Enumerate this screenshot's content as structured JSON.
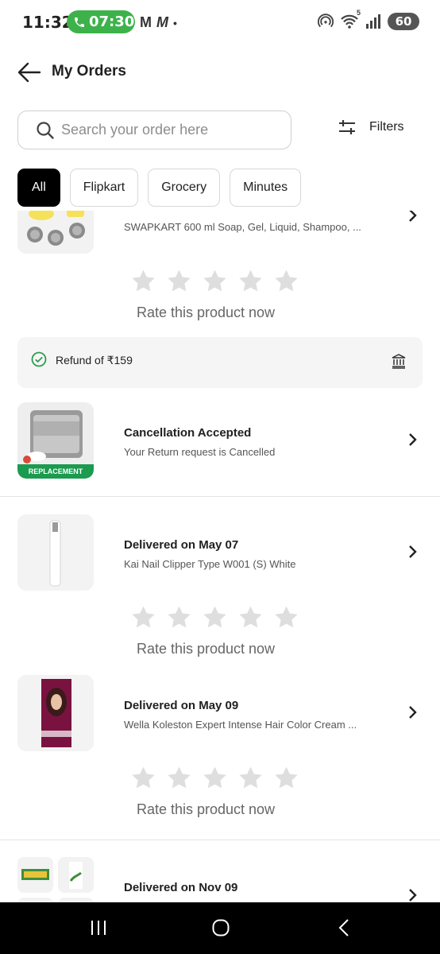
{
  "status_bar": {
    "time": "11:32",
    "call_time": "07:30",
    "left_icons": [
      "M",
      "M",
      "•"
    ],
    "wifi_label": "5",
    "battery": "60"
  },
  "header": {
    "title": "My Orders"
  },
  "search": {
    "placeholder": "Search your order here",
    "value": ""
  },
  "filters": {
    "label": "Filters"
  },
  "tabs": [
    {
      "label": "All",
      "active": true
    },
    {
      "label": "Flipkart",
      "active": false
    },
    {
      "label": "Grocery",
      "active": false
    },
    {
      "label": "Minutes",
      "active": false
    }
  ],
  "orders": [
    {
      "subtitle": "SWAPKART 600 ml Soap, Gel, Liquid, Shampoo, ...",
      "rate_label": "Rate this product now",
      "refund": "Refund of ₹159"
    },
    {
      "title": "Cancellation Accepted",
      "subtitle": "Your Return request is Cancelled",
      "badge": "REPLACEMENT"
    },
    {
      "title": "Delivered on May 07",
      "subtitle": "Kai Nail Clipper Type W001 (S) White",
      "rate_label": "Rate this product now"
    },
    {
      "title": "Delivered on May 09",
      "subtitle": "Wella Koleston Expert Intense Hair Color Cream ...",
      "rate_label": "Rate this product now"
    },
    {
      "title": "Delivered on Nov 09"
    }
  ],
  "colors": {
    "call_pill": "#3db24b",
    "replacement_badge": "#1a9b4f",
    "refund_check": "#2e9b4e",
    "star": "#dedede"
  }
}
